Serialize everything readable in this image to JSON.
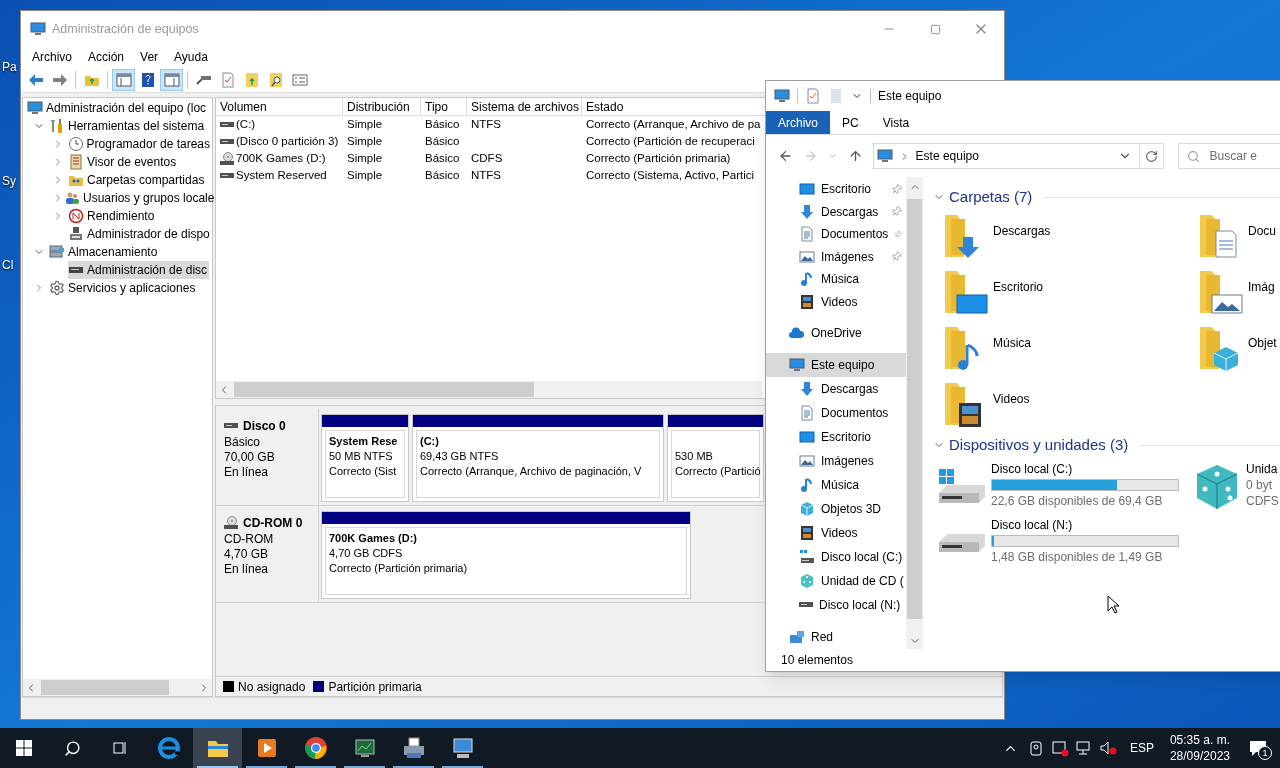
{
  "desktop": {
    "icon_labels": [
      "Pa",
      "Sy",
      "Cl"
    ]
  },
  "management": {
    "title": "Administración de equipos",
    "menu": [
      "Archivo",
      "Acción",
      "Ver",
      "Ayuda"
    ],
    "toolbar": [
      {
        "pressed": false
      },
      {
        "pressed": false
      },
      {
        "pressed": false
      },
      {
        "pressed": true
      },
      {
        "pressed": false
      },
      {
        "pressed": true
      },
      {
        "pressed": false
      },
      {
        "pressed": false
      },
      {
        "pressed": false
      },
      {
        "pressed": false
      },
      {
        "pressed": false
      }
    ],
    "tree": [
      {
        "label": "Administración del equipo (loc",
        "selected": false,
        "children": [
          {
            "label": "Herramientas del sistema",
            "expanded": true,
            "selected": false,
            "children": [
              {
                "label": "Programador de tareas",
                "expanded": false,
                "selected": false
              },
              {
                "label": "Visor de eventos",
                "expanded": false,
                "selected": false
              },
              {
                "label": "Carpetas compartidas",
                "expanded": false,
                "selected": false
              },
              {
                "label": "Usuarios y grupos locale",
                "expanded": false,
                "selected": false
              },
              {
                "label": "Rendimiento",
                "expanded": false,
                "selected": false
              },
              {
                "label": "Administrador de dispo",
                "selected": false
              }
            ]
          },
          {
            "label": "Almacenamiento",
            "expanded": true,
            "selected": false,
            "children": [
              {
                "label": "Administración de disc",
                "selected": true
              }
            ]
          },
          {
            "label": "Servicios y aplicaciones",
            "expanded": false,
            "selected": false
          }
        ]
      }
    ],
    "volumes": {
      "columns": [
        "Volumen",
        "Distribución",
        "Tipo",
        "Sistema de archivos",
        "Estado"
      ],
      "rows": [
        {
          "kind": "disk",
          "cells": [
            " (C:)",
            "Simple",
            "Básico",
            "NTFS",
            "Correcto (Arranque, Archivo de pa"
          ]
        },
        {
          "kind": "disk",
          "cells": [
            "(Disco 0 partición 3)",
            "Simple",
            "Básico",
            "",
            "Correcto (Partición de recuperaci"
          ]
        },
        {
          "kind": "cdrom",
          "cells": [
            "700K Games (D:)",
            "Simple",
            "Básico",
            "CDFS",
            "Correcto (Partición primaria)"
          ]
        },
        {
          "kind": "disk",
          "cells": [
            "System Reserved",
            "Simple",
            "Básico",
            "NTFS",
            "Correcto (Sistema, Activo, Partici"
          ]
        }
      ]
    },
    "disks": [
      {
        "kind": "disk",
        "name": "Disco 0",
        "details": [
          "Básico",
          "70,00 GB",
          "En línea"
        ],
        "partitions": [
          {
            "kind": "primary",
            "name": "System Rese",
            "lines": [
              "50 MB NTFS",
              "Correcto (Sist"
            ]
          },
          {
            "kind": "primary",
            "name": " (C:)",
            "lines": [
              "69,43 GB NTFS",
              "Correcto (Arranque, Archivo de paginación, V"
            ]
          },
          {
            "kind": "primary",
            "lines": [
              "530 MB",
              "Correcto (Partició"
            ]
          }
        ]
      },
      {
        "kind": "cdrom",
        "name": "CD-ROM 0",
        "details": [
          "CD-ROM",
          "4,70 GB",
          "En línea"
        ],
        "partitions": [
          {
            "kind": "primary",
            "name": "700K Games  (D:)",
            "lines": [
              "4,70 GB CDFS",
              "Correcto (Partición primaria)"
            ]
          }
        ]
      }
    ],
    "legend": [
      {
        "label": "No asignado",
        "color": "#000000"
      },
      {
        "label": "Partición primaria",
        "color": "#000080"
      }
    ]
  },
  "explorer": {
    "title": "Este equipo",
    "ribbon_tabs": [
      {
        "label": "Archivo",
        "selected": true
      },
      {
        "label": "PC",
        "selected": false
      },
      {
        "label": "Vista",
        "selected": false
      }
    ],
    "address": "Este equipo",
    "search_placeholder": "Buscar e",
    "quick_access": [
      {
        "label": "Escritorio",
        "pinned": true,
        "selected": false
      },
      {
        "label": "Descargas",
        "pinned": true,
        "selected": false
      },
      {
        "label": "Documentos",
        "pinned": true,
        "selected": false
      },
      {
        "label": "Imágenes",
        "pinned": true,
        "selected": false
      },
      {
        "label": "Música",
        "pinned": false,
        "selected": false
      },
      {
        "label": "Videos",
        "pinned": false,
        "selected": false
      }
    ],
    "nav_roots": [
      {
        "label": "OneDrive",
        "selected": false
      },
      {
        "label": "Este equipo",
        "selected": true,
        "children": [
          {
            "label": "Descargas",
            "selected": false
          },
          {
            "label": "Documentos",
            "selected": false
          },
          {
            "label": "Escritorio",
            "selected": false
          },
          {
            "label": "Imágenes",
            "selected": false
          },
          {
            "label": "Música",
            "selected": false
          },
          {
            "label": "Objetos 3D",
            "selected": false
          },
          {
            "label": "Videos",
            "selected": false
          },
          {
            "label": "Disco local (C:)",
            "selected": false
          },
          {
            "label": "Unidad de CD (",
            "selected": false
          },
          {
            "label": "Disco local (N:)",
            "selected": false
          }
        ]
      },
      {
        "label": "Red",
        "selected": false
      }
    ],
    "groups": [
      {
        "kind": "folders",
        "title": "Carpetas (7)",
        "expanded": true,
        "items": [
          {
            "label": "Descargas"
          },
          {
            "label": "Docu"
          },
          {
            "label": "Escritorio"
          },
          {
            "label": "Imág"
          },
          {
            "label": "Música"
          },
          {
            "label": "Objet"
          },
          {
            "label": "Videos"
          }
        ]
      },
      {
        "kind": "drives",
        "title": "Dispositivos y unidades (3)",
        "expanded": true,
        "items": [
          {
            "kind": "system_drive",
            "label": "Disco local (C:)",
            "level": 0.674,
            "details": [
              "22,6 GB disponibles de 69,4 GB"
            ]
          },
          {
            "kind": "cd_drive",
            "label": "Unida",
            "details": [
              "0 byt",
              "CDFS"
            ]
          },
          {
            "kind": "drive",
            "label": "Disco local (N:)",
            "level": 0.007,
            "details": [
              "1,48 GB disponibles de 1,49 GB"
            ]
          }
        ]
      }
    ],
    "status": "10 elementos"
  },
  "taskbar": {
    "apps": [
      {
        "open": false,
        "active": false
      },
      {
        "open": true,
        "active": true
      },
      {
        "open": true,
        "active": false
      },
      {
        "open": true,
        "active": false
      },
      {
        "open": true,
        "active": false
      },
      {
        "open": true,
        "active": false
      },
      {
        "open": true,
        "active": false
      }
    ],
    "language": "ESP",
    "time": "05:35 a. m.",
    "date": "28/09/2023",
    "notifications": "1"
  }
}
